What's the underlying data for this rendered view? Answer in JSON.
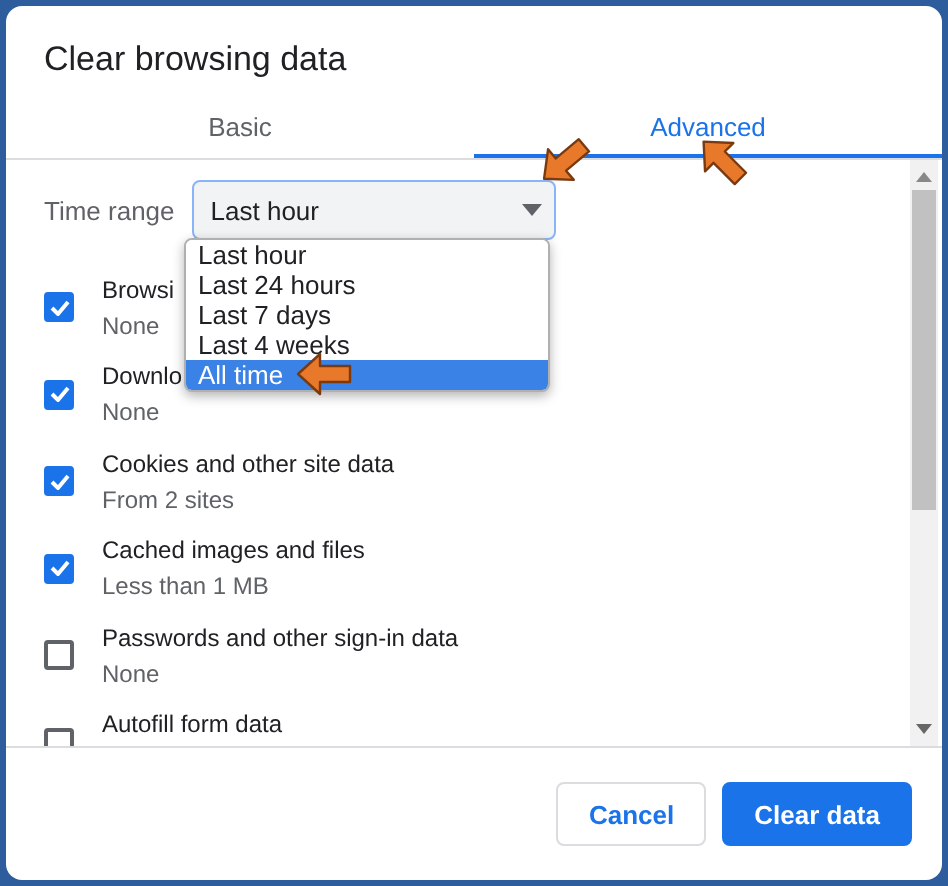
{
  "dialog": {
    "title": "Clear browsing data"
  },
  "tabs": [
    {
      "label": "Basic",
      "selected": false
    },
    {
      "label": "Advanced",
      "selected": true
    }
  ],
  "time_range": {
    "label": "Time range",
    "value": "Last hour",
    "expanded": true,
    "options": [
      {
        "label": "Last hour",
        "highlighted": false
      },
      {
        "label": "Last 24 hours",
        "highlighted": false
      },
      {
        "label": "Last 7 days",
        "highlighted": false
      },
      {
        "label": "Last 4 weeks",
        "highlighted": false
      },
      {
        "label": "All time",
        "highlighted": true
      }
    ]
  },
  "items": [
    {
      "label": "Browsi",
      "detail": "None",
      "checked": true
    },
    {
      "label": "Downlo",
      "detail": "None",
      "checked": true
    },
    {
      "label": "Cookies and other site data",
      "detail": "From 2 sites",
      "checked": true
    },
    {
      "label": "Cached images and files",
      "detail": "Less than 1 MB",
      "checked": true
    },
    {
      "label": "Passwords and other sign-in data",
      "detail": "None",
      "checked": false
    },
    {
      "label": "Autofill form data",
      "checked": false
    }
  ],
  "buttons": [
    {
      "label": "Cancel",
      "kind": "secondary"
    },
    {
      "label": "Clear data",
      "kind": "primary"
    }
  ]
}
